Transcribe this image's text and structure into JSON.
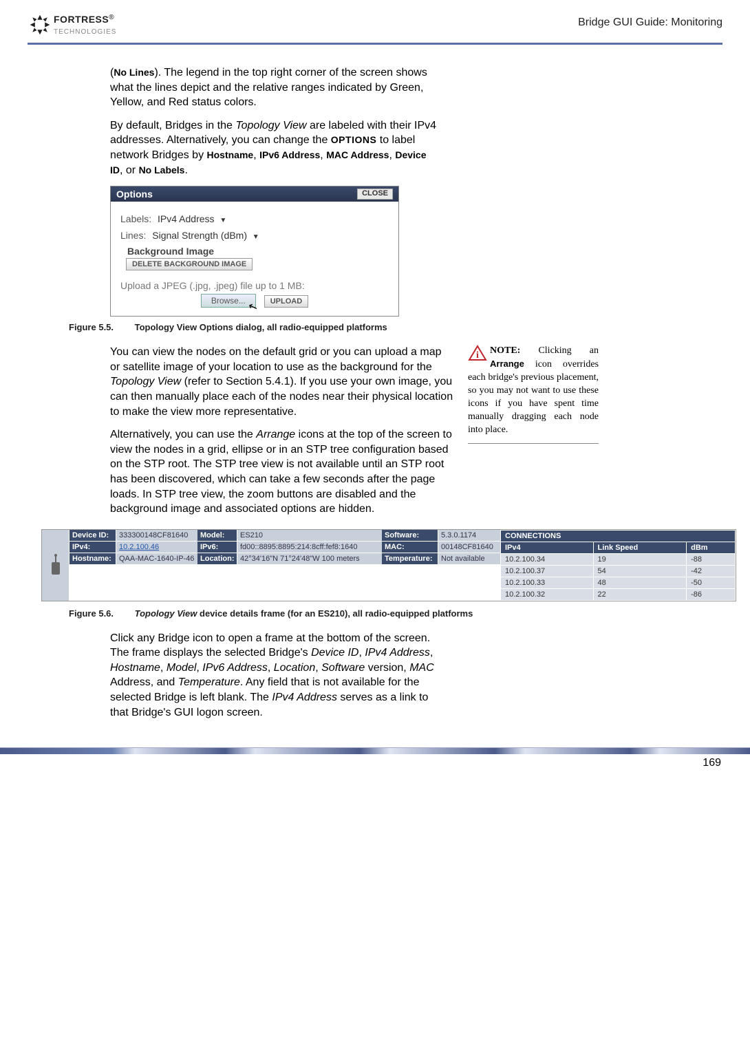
{
  "header": {
    "brand_bold": "FORTRESS",
    "brand_light": "TECHNOLOGIES",
    "reg": "®",
    "doc_title": "Bridge GUI Guide: Monitoring"
  },
  "para1_pre": "(",
  "para1_bold1": "No Lines",
  "para1_post": "). The legend in the top right corner of the screen shows what the lines depict and the relative ranges indicated by Green, Yellow, and Red status colors.",
  "para2_a": "By default, Bridges in the ",
  "para2_i1": "Topology View",
  "para2_b": " are labeled with their IPv4 addresses. Alternatively, you can change the ",
  "para2_sc": "OPTIONS",
  "para2_c": " to label network Bridges by ",
  "para2_bold1": "Hostname",
  "para2_sep": ", ",
  "para2_bold2": "IPv6 Address",
  "para2_bold3": "MAC Address",
  "para2_bold4": "Device ID",
  "para2_or": ", or ",
  "para2_bold5": "No Labels",
  "para2_end": ".",
  "options": {
    "title": "Options",
    "close": "CLOSE",
    "labels_lbl": "Labels:",
    "labels_val": "IPv4 Address",
    "lines_lbl": "Lines:",
    "lines_val": "Signal Strength (dBm)",
    "bg_heading": "Background Image",
    "delete_btn": "DELETE BACKGROUND IMAGE",
    "upload_hint": "Upload a JPEG (.jpg, .jpeg) file up to 1 MB:",
    "browse": "Browse...",
    "upload": "UPLOAD"
  },
  "fig55_num": "Figure 5.5.",
  "fig55_cap": "Topology View Options dialog, all radio-equipped platforms",
  "para3_a": "You can view the nodes on the default grid or you can upload a map or satellite image of your location to use as the background for the ",
  "para3_i1": "Topology View",
  "para3_b": " (refer to Section 5.4.1). If you use your own image, you can then manually place each of the nodes near their physical location to make the view more representative.",
  "para4_a": "Alternatively, you can use the ",
  "para4_i1": "Arrange",
  "para4_b": " icons at the top of the screen to view the nodes in a grid, ellipse or in an STP tree configuration based on the STP root. The STP tree view is not available until an STP root has been discovered, which can take a few seconds after the page loads. In STP tree view, the zoom buttons are disabled and the background image and associated options are hidden.",
  "sidenote": {
    "note_lbl": "NOTE:",
    "a": " Clicking an ",
    "bold": "Arrange",
    "b": " icon overrides each bridge's previous placement, so you may not want to use these icons if you have spent time manually dragging each node into place."
  },
  "details": {
    "device_id_lbl": "Device ID:",
    "device_id": "333300148CF81640",
    "ipv4_lbl": "IPv4:",
    "ipv4": "10.2.100.46",
    "hostname_lbl": "Hostname:",
    "hostname": "QAA-MAC-1640-IP-46",
    "model_lbl": "Model:",
    "model": "ES210",
    "ipv6_lbl": "IPv6:",
    "ipv6": "fd00::8895:8895:214:8cff:fef8:1640",
    "location_lbl": "Location:",
    "location": "42°34'16\"N 71°24'48\"W 100 meters",
    "software_lbl": "Software:",
    "software": "5.3.0.1174",
    "mac_lbl": "MAC:",
    "mac": "00148CF81640",
    "temp_lbl": "Temperature:",
    "temp": "Not available",
    "conn_title": "CONNECTIONS",
    "col1": "IPv4",
    "col2": "Link Speed",
    "col3": "dBm",
    "rows": [
      {
        "ip": "10.2.100.34",
        "ls": "19",
        "dbm": "-88"
      },
      {
        "ip": "10.2.100.37",
        "ls": "54",
        "dbm": "-42"
      },
      {
        "ip": "10.2.100.33",
        "ls": "48",
        "dbm": "-50"
      },
      {
        "ip": "10.2.100.32",
        "ls": "22",
        "dbm": "-86"
      }
    ]
  },
  "fig56_num": "Figure 5.6.",
  "fig56_cap_i": "Topology View",
  "fig56_cap_rest": " device details frame (for an ES210), all radio-equipped platforms",
  "para5_a": "Click any Bridge icon to open a frame at the bottom of the screen. The frame displays the selected Bridge's ",
  "para5_i1": "Device ID",
  "para5_s": ", ",
  "para5_i2": "IPv4 Address",
  "para5_i3": "Hostname",
  "para5_i4": "Model",
  "para5_i5": "IPv6 Address",
  "para5_i6": "Location",
  "para5_i7": "Software",
  "para5_mid1": " version, ",
  "para5_i8": "MAC",
  "para5_mid2": " Address, and ",
  "para5_i9": "Temperature",
  "para5_b": ". Any field that is not available for the selected Bridge is left blank. The ",
  "para5_i10": "IPv4 Address",
  "para5_c": " serves as a link to that Bridge's GUI logon screen.",
  "page_number": "169"
}
